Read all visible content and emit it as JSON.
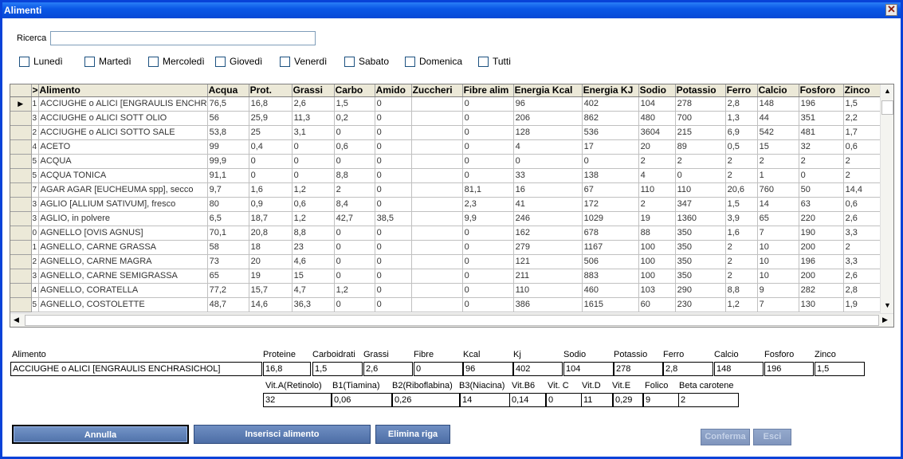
{
  "window": {
    "title": "Alimenti",
    "close_glyph": "✕"
  },
  "search": {
    "label": "Ricerca",
    "value": ""
  },
  "days": [
    "Lunedì",
    "Martedì",
    "Mercoledì",
    "Giovedì",
    "Venerdì",
    "Sabato",
    "Domenica",
    "Tutti"
  ],
  "grid": {
    "columns": [
      ">",
      "Alimento",
      "Acqua",
      "Prot.",
      "Grassi",
      "Carbo",
      "Amido",
      "Zuccheri",
      "Fibre alim",
      "Energia Kcal",
      "Energia KJ",
      "Sodio",
      "Potassio",
      "Ferro",
      "Calcio",
      "Fosforo",
      "Zinco"
    ],
    "rows": [
      [
        "1",
        "ACCIUGHE o ALICI [ENGRAULIS ENCHR",
        "76,5",
        "16,8",
        "2,6",
        "1,5",
        "0",
        "",
        "0",
        "96",
        "402",
        "104",
        "278",
        "2,8",
        "148",
        "196",
        "1,5"
      ],
      [
        "3",
        "ACCIUGHE o ALICI SOTT OLIO",
        "56",
        "25,9",
        "11,3",
        "0,2",
        "0",
        "",
        "0",
        "206",
        "862",
        "480",
        "700",
        "1,3",
        "44",
        "351",
        "2,2"
      ],
      [
        "2",
        "ACCIUGHE o ALICI SOTTO SALE",
        "53,8",
        "25",
        "3,1",
        "0",
        "0",
        "",
        "0",
        "128",
        "536",
        "3604",
        "215",
        "6,9",
        "542",
        "481",
        "1,7"
      ],
      [
        "4",
        "ACETO",
        "99",
        "0,4",
        "0",
        "0,6",
        "0",
        "",
        "0",
        "4",
        "17",
        "20",
        "89",
        "0,5",
        "15",
        "32",
        "0,6"
      ],
      [
        "5",
        "ACQUA",
        "99,9",
        "0",
        "0",
        "0",
        "0",
        "",
        "0",
        "0",
        "0",
        "2",
        "2",
        "2",
        "2",
        "2",
        "2"
      ],
      [
        "5",
        "ACQUA TONICA",
        "91,1",
        "0",
        "0",
        "8,8",
        "0",
        "",
        "0",
        "33",
        "138",
        "4",
        "0",
        "2",
        "1",
        "0",
        "2"
      ],
      [
        "7",
        "AGAR AGAR [EUCHEUMA spp], secco",
        "9,7",
        "1,6",
        "1,2",
        "2",
        "0",
        "",
        "81,1",
        "16",
        "67",
        "110",
        "110",
        "20,6",
        "760",
        "50",
        "14,4"
      ],
      [
        "3",
        "AGLIO [ALLIUM SATIVUM], fresco",
        "80",
        "0,9",
        "0,6",
        "8,4",
        "0",
        "",
        "2,3",
        "41",
        "172",
        "2",
        "347",
        "1,5",
        "14",
        "63",
        "0,6"
      ],
      [
        "3",
        "AGLIO, in polvere",
        "6,5",
        "18,7",
        "1,2",
        "42,7",
        "38,5",
        "",
        "9,9",
        "246",
        "1029",
        "19",
        "1360",
        "3,9",
        "65",
        "220",
        "2,6"
      ],
      [
        "0",
        "AGNELLO [OVIS AGNUS]",
        "70,1",
        "20,8",
        "8,8",
        "0",
        "0",
        "",
        "0",
        "162",
        "678",
        "88",
        "350",
        "1,6",
        "7",
        "190",
        "3,3"
      ],
      [
        "1",
        "AGNELLO, CARNE GRASSA",
        "58",
        "18",
        "23",
        "0",
        "0",
        "",
        "0",
        "279",
        "1167",
        "100",
        "350",
        "2",
        "10",
        "200",
        "2"
      ],
      [
        "2",
        "AGNELLO, CARNE MAGRA",
        "73",
        "20",
        "4,6",
        "0",
        "0",
        "",
        "0",
        "121",
        "506",
        "100",
        "350",
        "2",
        "10",
        "196",
        "3,3"
      ],
      [
        "3",
        "AGNELLO, CARNE SEMIGRASSA",
        "65",
        "19",
        "15",
        "0",
        "0",
        "",
        "0",
        "211",
        "883",
        "100",
        "350",
        "2",
        "10",
        "200",
        "2,6"
      ],
      [
        "4",
        "AGNELLO, CORATELLA",
        "77,2",
        "15,7",
        "4,7",
        "1,2",
        "0",
        "",
        "0",
        "110",
        "460",
        "103",
        "290",
        "8,8",
        "9",
        "282",
        "2,8"
      ],
      [
        "5",
        "AGNELLO, COSTOLETTE",
        "48,7",
        "14,6",
        "36,3",
        "0",
        "0",
        "",
        "0",
        "386",
        "1615",
        "60",
        "230",
        "1,2",
        "7",
        "130",
        "1,9"
      ]
    ]
  },
  "details": {
    "headers": [
      "Alimento",
      "Proteine",
      "Carboidrati",
      "Grassi",
      "Fibre",
      "Kcal",
      "Kj",
      "Sodio",
      "Potassio",
      "Ferro",
      "Calcio",
      "Fosforo",
      "Zinco"
    ],
    "values": [
      "ACCIUGHE o ALICI [ENGRAULIS ENCHRASICHOL]",
      "16,8",
      "1,5",
      "2,6",
      "0",
      "96",
      "402",
      "104",
      "278",
      "2,8",
      "148",
      "196",
      "1,5"
    ]
  },
  "vitamins": {
    "headers": [
      "Vit.A(Retinolo)",
      "B1(Tiamina)",
      "B2(Riboflabina)",
      "B3(Niacina)",
      "Vit.B6",
      "Vit. C",
      "Vit.D",
      "Vit.E",
      "Folico",
      "Beta carotene"
    ],
    "values": [
      "32",
      "0,06",
      "0,26",
      "14",
      "0,14",
      "0",
      "11",
      "0,29",
      "9",
      "2"
    ]
  },
  "buttons": {
    "annulla": "Annulla",
    "inserisci": "Inserisci alimento",
    "elimina": "Elimina riga",
    "conferma": "Conferma",
    "esci": "Esci"
  }
}
